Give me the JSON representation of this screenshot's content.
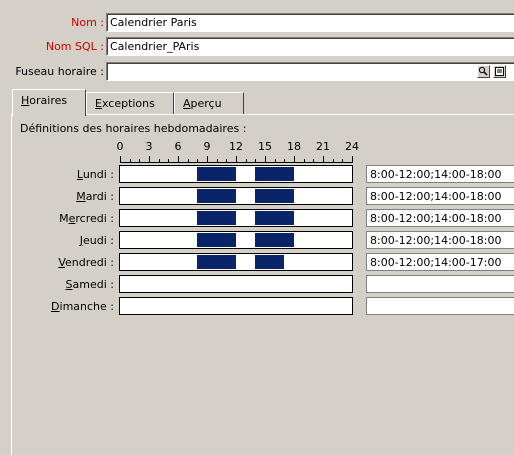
{
  "form": {
    "name_label": "Nom :",
    "name_value": "Calendrier Paris",
    "sql_label": "Nom SQL :",
    "sql_value": "Calendrier_PAris",
    "tz_label": "Fuseau horaire :",
    "tz_value": ""
  },
  "tabs": [
    {
      "key": "H",
      "rest": "oraires",
      "active": true
    },
    {
      "key": "E",
      "rest": "xceptions",
      "active": false
    },
    {
      "key": "A",
      "rest": "perçu",
      "active": false
    }
  ],
  "schedule": {
    "heading": "Définitions des horaires hebdomadaires :",
    "scale_labels": [
      "0",
      "3",
      "6",
      "9",
      "12",
      "15",
      "18",
      "21",
      "24"
    ],
    "days": [
      {
        "pre": "",
        "key": "L",
        "post": "undi :",
        "hours": "8:00-12:00;14:00-18:00",
        "segments": [
          [
            8,
            12
          ],
          [
            14,
            18
          ]
        ]
      },
      {
        "pre": "",
        "key": "M",
        "post": "ardi :",
        "hours": "8:00-12:00;14:00-18:00",
        "segments": [
          [
            8,
            12
          ],
          [
            14,
            18
          ]
        ]
      },
      {
        "pre": "M",
        "key": "e",
        "post": "rcredi :",
        "hours": "8:00-12:00;14:00-18:00",
        "segments": [
          [
            8,
            12
          ],
          [
            14,
            18
          ]
        ]
      },
      {
        "pre": "",
        "key": "J",
        "post": "eudi :",
        "hours": "8:00-12:00;14:00-18:00",
        "segments": [
          [
            8,
            12
          ],
          [
            14,
            18
          ]
        ]
      },
      {
        "pre": "",
        "key": "V",
        "post": "endredi :",
        "hours": "8:00-12:00;14:00-17:00",
        "segments": [
          [
            8,
            12
          ],
          [
            14,
            17
          ]
        ]
      },
      {
        "pre": "",
        "key": "S",
        "post": "amedi :",
        "hours": "",
        "segments": []
      },
      {
        "pre": "",
        "key": "D",
        "post": "imanche :",
        "hours": "",
        "segments": []
      }
    ]
  },
  "icons": {
    "search": "magnifier-icon",
    "list": "list-icon"
  }
}
